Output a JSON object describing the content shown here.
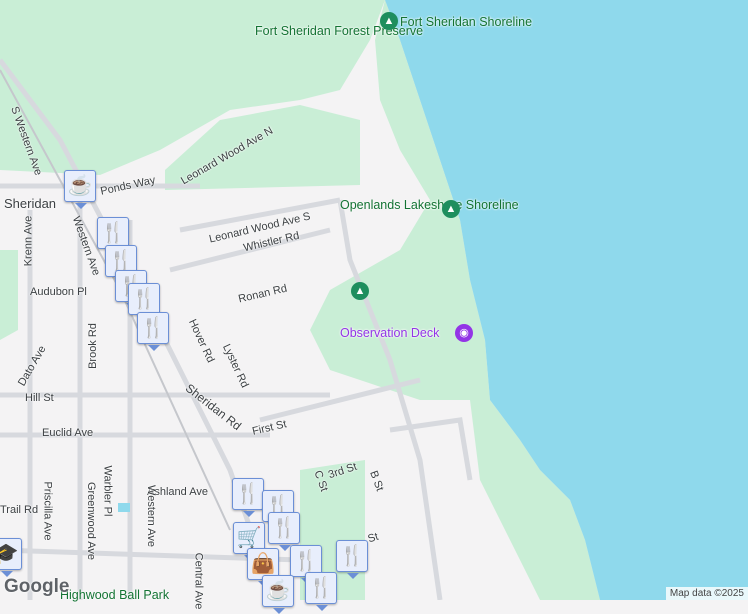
{
  "parks": {
    "fort_sheridan_forest": "Fort Sheridan Forest Preserve",
    "fort_sheridan_shoreline": "Fort Sheridan Shoreline",
    "openlands": "Openlands Lakeshore Shoreline",
    "ball_park": "Highwood Ball Park"
  },
  "poi": {
    "observation_deck": "Observation Deck",
    "station": "Sheridan"
  },
  "streets": {
    "leonard_n": "Leonard Wood Ave N",
    "leonard_s": "Leonard Wood Ave S",
    "whistler": "Whistler Rd",
    "ronan": "Ronan Rd",
    "lyster": "Lyster Rd",
    "sheridan_rd": "Sheridan Rd",
    "first": "First St",
    "third": "3rd St",
    "c_st": "C St",
    "b_st": "B St",
    "audubon": "Audubon Pl",
    "hill": "Hill St",
    "euclid": "Euclid Ave",
    "ashland": "Ashland Ave",
    "krenn": "Krenn Ave",
    "western": "Western Ave",
    "western2": "Western Ave",
    "s_western": "S Western Ave",
    "brook": "Brook Rd",
    "dato": "Dato Ave",
    "warbler": "Warbler Pl",
    "priscilla": "Priscilla Ave",
    "greenwood": "Greenwood Ave",
    "trail": "Trail Rd",
    "central": "Central Ave",
    "ponds": "Ponds Way",
    "hover": "Hover Rd",
    "st": "St"
  },
  "markers": [
    "coffee-icon",
    "restaurant-icon",
    "restaurant-icon",
    "restaurant-icon",
    "restaurant-icon",
    "restaurant-icon",
    "shopping-cart-icon",
    "shopping-bag-icon",
    "coffee-icon",
    "restaurant-icon",
    "school-icon"
  ],
  "footer": {
    "logo": "Google",
    "attribution": "Map data ©2025"
  },
  "colors": {
    "water": "#8fd9ec",
    "park": "#c9eed6",
    "land": "#f4f3f4",
    "road": "#dadce0"
  }
}
